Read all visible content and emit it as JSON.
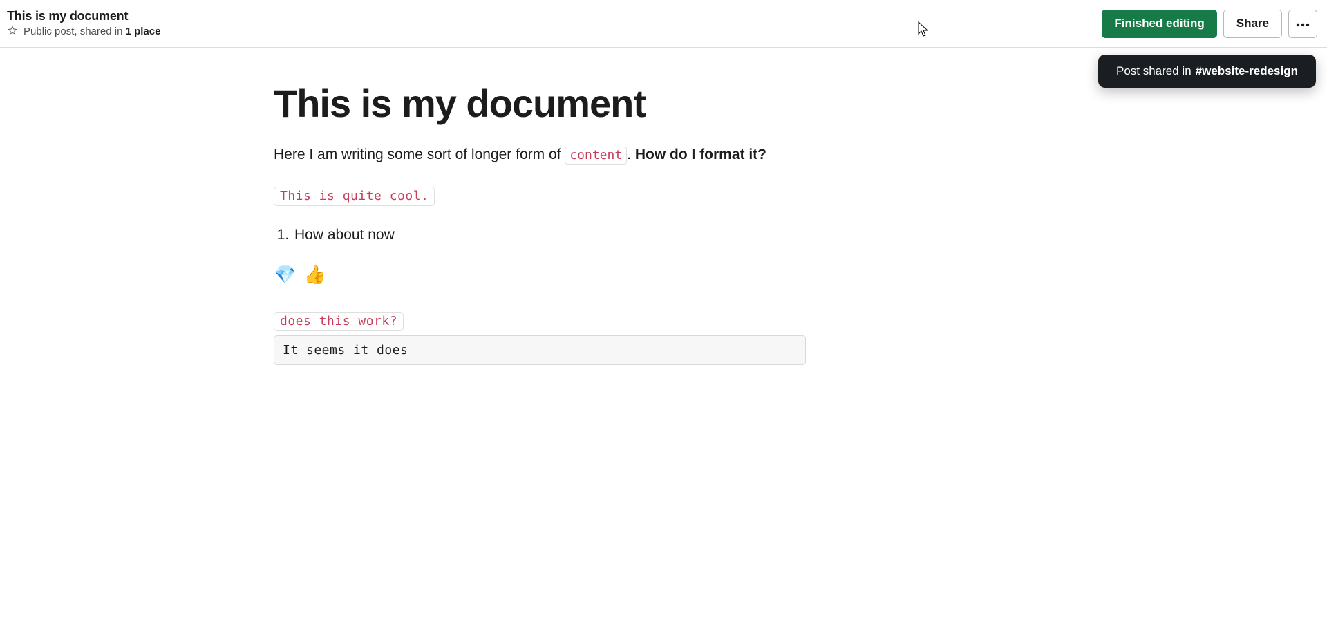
{
  "header": {
    "title": "This is my document",
    "sub_prefix": "Public post, shared in ",
    "sub_bold": "1 place",
    "finish_label": "Finished editing",
    "share_label": "Share"
  },
  "toast": {
    "prefix": "Post shared in ",
    "channel": "#website-redesign"
  },
  "doc": {
    "h1": "This is my document",
    "p1_a": "Here I am writing some sort of longer form of ",
    "p1_code": "content",
    "p1_b": ". ",
    "p1_strong": "How do I format it?",
    "code1": "This is quite cool.",
    "list": [
      "How about now"
    ],
    "emoji": "💎 👍",
    "code2": "does this work?",
    "quote": "It seems it does"
  }
}
